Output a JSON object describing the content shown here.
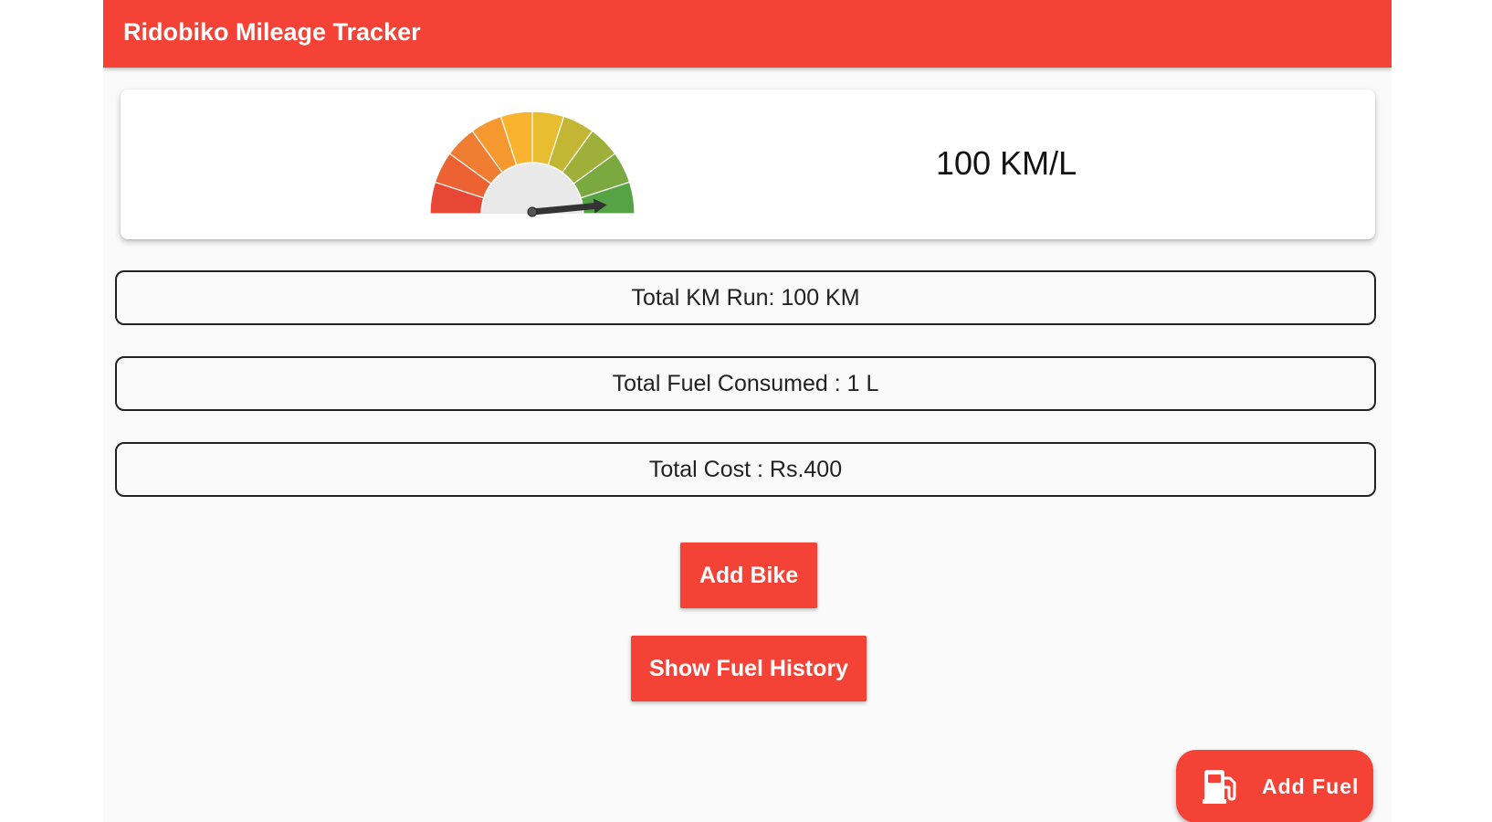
{
  "appbar": {
    "title": "Ridobiko Mileage Tracker"
  },
  "gauge": {
    "icon": "speedometer-gauge-icon",
    "level_fraction": 0.97,
    "mileage_text": "100 KM/L"
  },
  "stats": {
    "total_km": "Total KM Run: 100 KM",
    "total_fuel": "Total Fuel Consumed : 1 L",
    "total_cost": "Total Cost : Rs.400"
  },
  "buttons": {
    "add_bike": "Add Bike",
    "show_fuel_history": "Show Fuel History"
  },
  "fab": {
    "icon": "fuel-pump-icon",
    "label": "Add Fuel"
  },
  "colors": {
    "accent": "#f44336",
    "gauge_low": "#e53935",
    "gauge_mid": "#fbc02d",
    "gauge_high": "#43a047"
  }
}
